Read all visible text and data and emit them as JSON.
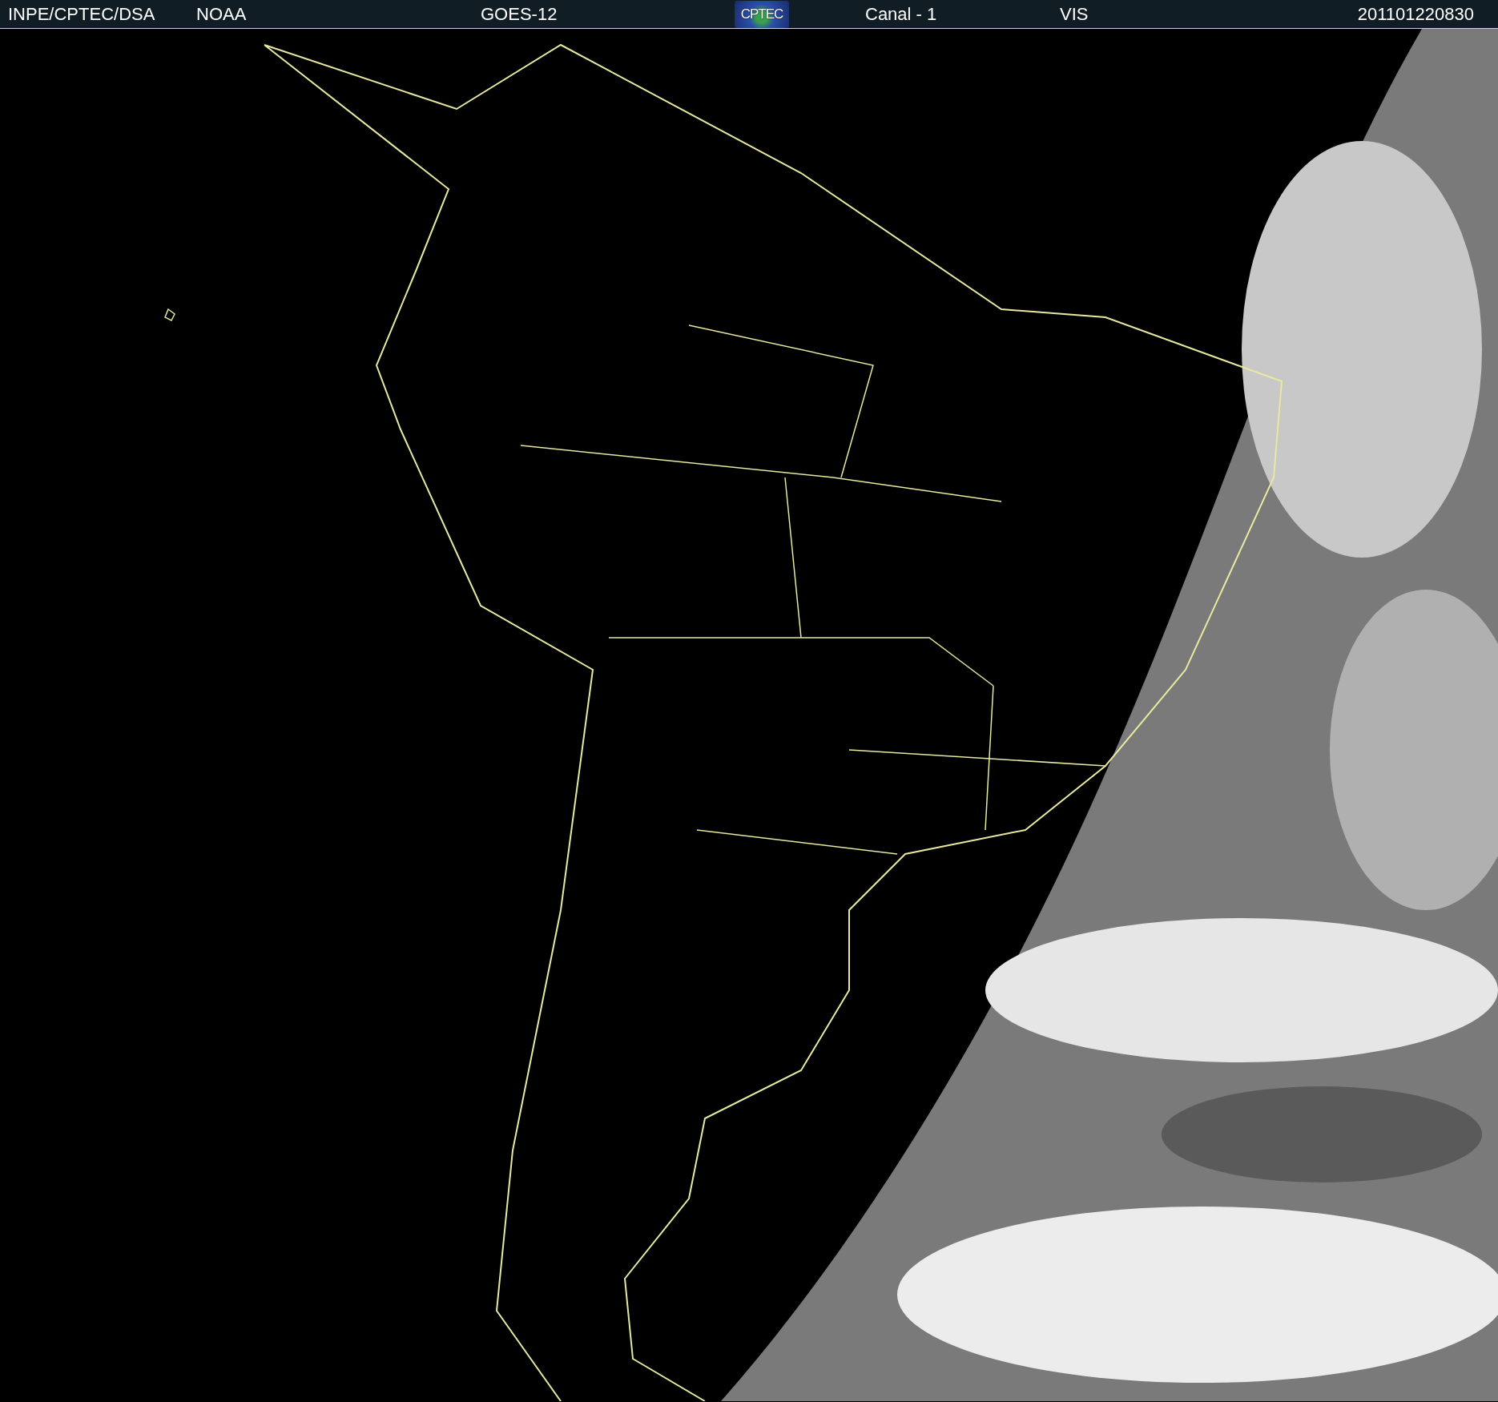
{
  "header": {
    "agency": "INPE/CPTEC/DSA",
    "source": "NOAA",
    "satellite": "GOES-12",
    "logo": "CPTEC",
    "channel": "Canal - 1",
    "band": "VIS",
    "timestamp": "201101220830"
  }
}
